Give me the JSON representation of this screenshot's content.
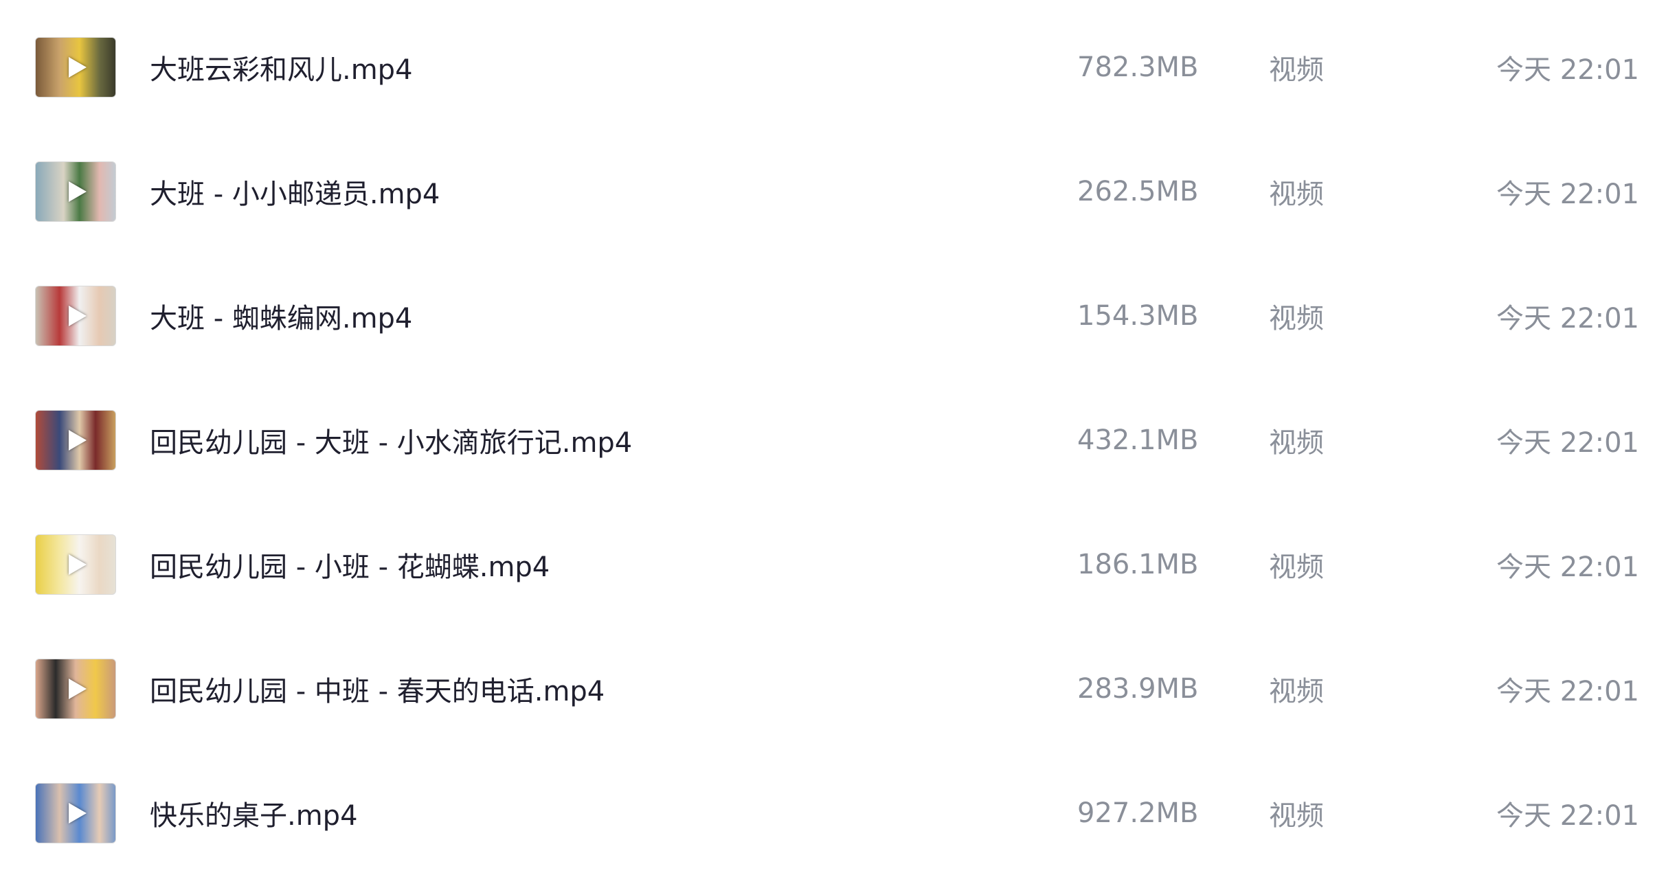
{
  "files": [
    {
      "name": "大班云彩和风儿.mp4",
      "size": "782.3MB",
      "type": "视频",
      "time": "今天 22:01"
    },
    {
      "name": "大班 - 小小邮递员.mp4",
      "size": "262.5MB",
      "type": "视频",
      "time": "今天 22:01"
    },
    {
      "name": "大班 - 蜘蛛编网.mp4",
      "size": "154.3MB",
      "type": "视频",
      "time": "今天 22:01"
    },
    {
      "name": "回民幼儿园 - 大班 - 小水滴旅行记.mp4",
      "size": "432.1MB",
      "type": "视频",
      "time": "今天 22:01"
    },
    {
      "name": "回民幼儿园 - 小班 - 花蝴蝶.mp4",
      "size": "186.1MB",
      "type": "视频",
      "time": "今天 22:01"
    },
    {
      "name": "回民幼儿园 - 中班 - 春天的电话.mp4",
      "size": "283.9MB",
      "type": "视频",
      "time": "今天 22:01"
    },
    {
      "name": "快乐的桌子.mp4",
      "size": "927.2MB",
      "type": "视频",
      "time": "今天 22:01"
    }
  ],
  "icons": {
    "thumbnail_overlay": "play-icon"
  },
  "colors": {
    "name_text": "#1f1f2e",
    "meta_text": "#8a8f99",
    "background": "#ffffff"
  }
}
